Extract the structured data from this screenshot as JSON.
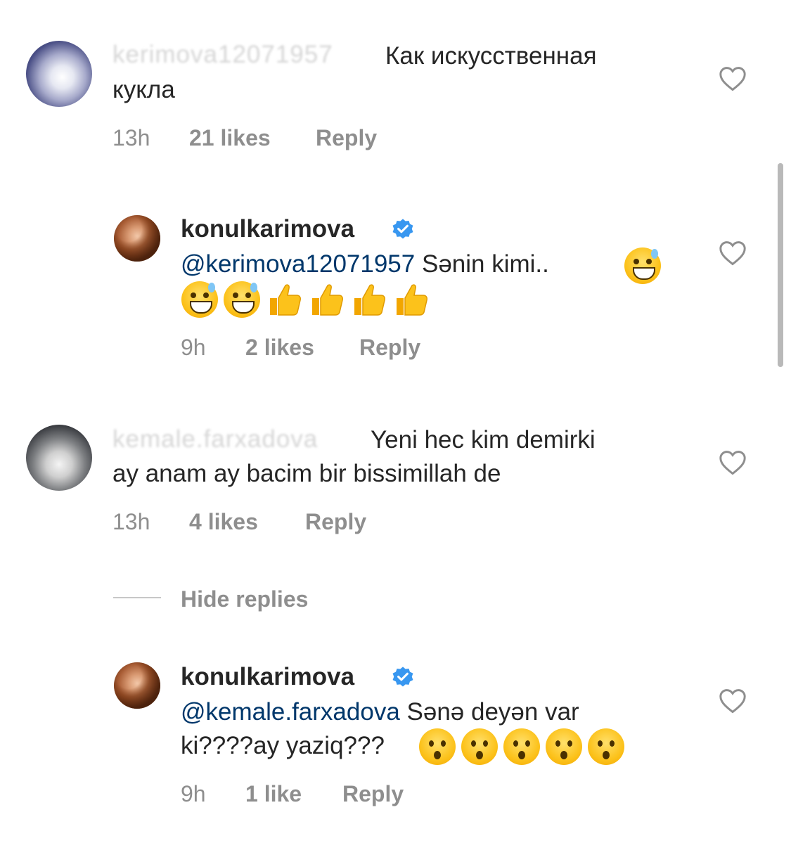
{
  "comments": [
    {
      "username": "kerimova12071957",
      "text_line1": "Как искусственная",
      "text_line2": "кукла",
      "time": "13h",
      "likes": "21 likes",
      "reply": "Reply"
    },
    {
      "username": "konulkarimova",
      "mention": "@kerimova12071957",
      "text": " Sənin kimi..",
      "time": "9h",
      "likes": "2 likes",
      "reply": "Reply",
      "is_reply": true
    },
    {
      "username": "kemale.farxadova",
      "text_line1": "Yeni hec kim demirki",
      "text_line2": "ay anam ay bacim bir bissimillah de",
      "time": "13h",
      "likes": "4 likes",
      "reply": "Reply"
    },
    {
      "username": "konulkarimova",
      "mention": "@kemale.farxadova",
      "text_line1": " Sənə deyən var",
      "text_line2": "ki????ay yaziq???",
      "time": "9h",
      "likes": "1 like",
      "reply": "Reply",
      "is_reply": true
    }
  ],
  "hide_replies": "Hide replies",
  "icons": {
    "like": "heart-outline-icon",
    "verified": "verified-badge-icon",
    "emoji_sweat": "grinning-sweat-emoji",
    "emoji_thumb": "thumbs-up-emoji",
    "emoji_hushed": "hushed-face-emoji"
  },
  "colors": {
    "text": "#262626",
    "meta": "#8e8e8e",
    "mention": "#00376b",
    "verified": "#3897f0"
  }
}
